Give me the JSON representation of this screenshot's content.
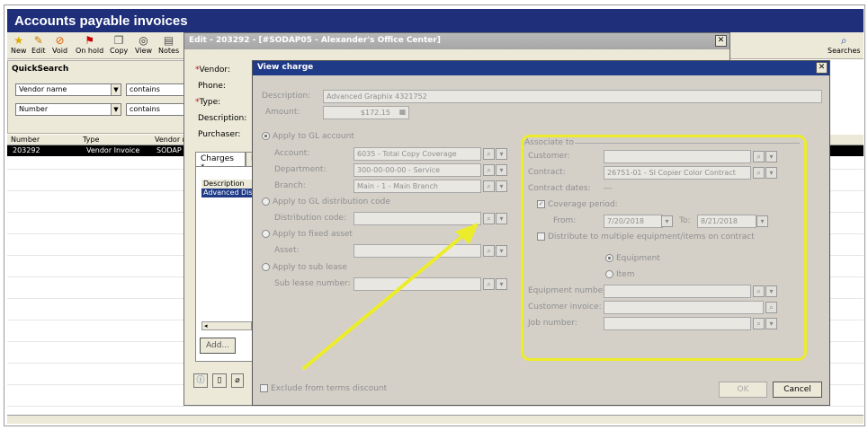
{
  "app": {
    "title": "Accounts payable invoices",
    "toolbar": [
      "New",
      "Edit",
      "Void",
      "On hold",
      "Copy",
      "View",
      "Notes"
    ],
    "searches_label": "Searches",
    "quicksearch": {
      "title": "QuickSearch",
      "field1": "Vendor name",
      "op1": "contains",
      "field2": "Number",
      "op2": "contains"
    },
    "grid": {
      "headers": [
        "Number",
        "Type",
        "Vendor n"
      ],
      "row": [
        "203292",
        "Vendor Invoice",
        "SODAP"
      ]
    }
  },
  "edit": {
    "title": "Edit - 203292 - [#SODAP05 - Alexander's Office Center]",
    "labels": [
      "Vendor:",
      "Phone:",
      "Type:",
      "Description:",
      "Purchaser:"
    ],
    "tab_charges": "Charges *",
    "tab_other": "I",
    "panel_header": "Description",
    "panel_row": "Advanced Dis",
    "add_btn": "Add..."
  },
  "view_charge": {
    "title": "View charge",
    "description_label": "Description:",
    "description_value": "Advanced Graphix 4321752",
    "amount_label": "Amount:",
    "amount_value": "$172.15",
    "apply_gl": "Apply to GL account",
    "account_label": "Account:",
    "account_value": "6035 - Total Copy Coverage",
    "department_label": "Department:",
    "department_value": "300-00-00-00 - Service",
    "branch_label": "Branch:",
    "branch_value": "Main - 1 - Main Branch",
    "apply_dist": "Apply to GL distribution code",
    "dist_label": "Distribution code:",
    "apply_fixed": "Apply to fixed asset",
    "asset_label": "Asset:",
    "apply_sub": "Apply to sub lease",
    "sub_label": "Sub lease number:",
    "exclude": "Exclude from terms discount",
    "ok": "OK",
    "cancel": "Cancel",
    "associate": {
      "title": "Associate to",
      "customer_label": "Customer:",
      "contract_label": "Contract:",
      "contract_value": "26751-01 - SI Copier Color Contract",
      "contract_dates_label": "Contract dates:",
      "contract_dates_value": "---",
      "coverage": "Coverage period:",
      "from_label": "From:",
      "from_value": "7/20/2018",
      "to_label": "To:",
      "to_value": "8/21/2018",
      "distribute": "Distribute to multiple equipment/items on contract",
      "equipment": "Equipment",
      "item": "Item",
      "equipment_number": "Equipment number:",
      "customer_invoice": "Customer invoice:",
      "job_number": "Job number:"
    }
  },
  "colors": {
    "highlight": "#ecec2a",
    "title_bar": "#1f2f7a",
    "arrow": "#ecec2a"
  }
}
